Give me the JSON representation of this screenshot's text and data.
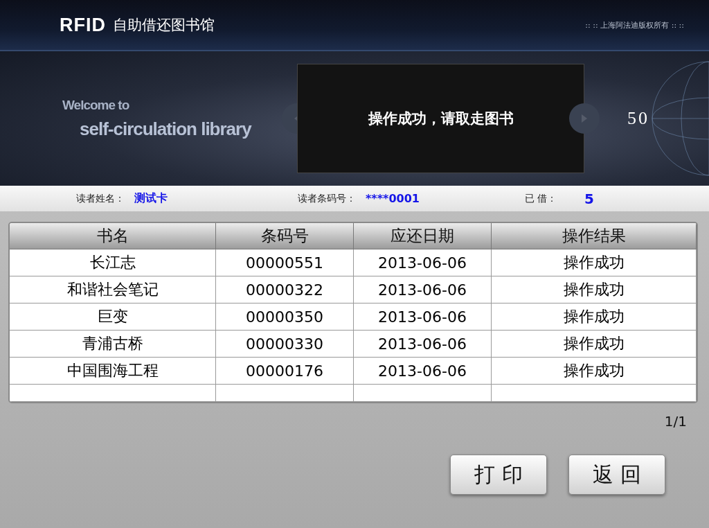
{
  "header": {
    "logo": "RFID",
    "title": "自助借还图书馆",
    "copyright": ":: :: 上海阿法迪版权所有 :: ::"
  },
  "banner": {
    "welcome": "Welcome to",
    "subtitle": "self-circulation library",
    "message": "操作成功，请取走图书",
    "countdown": "50"
  },
  "reader": {
    "name_label": "读者姓名：",
    "name": "测试卡",
    "barcode_label": "读者条码号：",
    "barcode": "****0001",
    "borrowed_label": "已 借：",
    "borrowed": "5"
  },
  "table": {
    "columns": [
      "书名",
      "条码号",
      "应还日期",
      "操作结果"
    ],
    "rows": [
      [
        "长江志",
        "00000551",
        "2013-06-06",
        "操作成功"
      ],
      [
        "和谐社会笔记",
        "00000322",
        "2013-06-06",
        "操作成功"
      ],
      [
        "巨变",
        "00000350",
        "2013-06-06",
        "操作成功"
      ],
      [
        "青浦古桥",
        "00000330",
        "2013-06-06",
        "操作成功"
      ],
      [
        "中国围海工程",
        "00000176",
        "2013-06-06",
        "操作成功"
      ]
    ]
  },
  "pager": "1/1",
  "buttons": [
    "打 印",
    "返 回"
  ]
}
